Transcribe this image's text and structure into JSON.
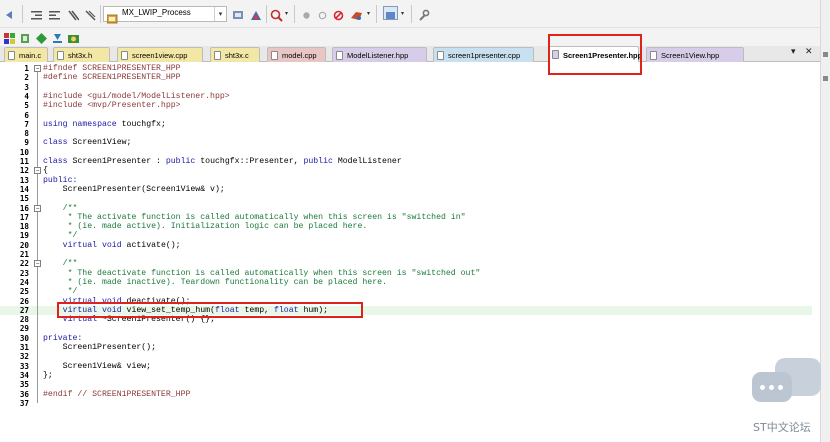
{
  "toolbar": {
    "process_combo": "MX_LWIP_Process",
    "colors": {
      "accent_red": "#e0221c"
    }
  },
  "tabs": [
    {
      "label": "main.c",
      "color": "#f3e7a6"
    },
    {
      "label": "sht3x.h",
      "color": "#f3e7a6"
    },
    {
      "label": "screen1view.cpp",
      "color": "#f3e7a6"
    },
    {
      "label": "sht3x.c",
      "color": "#f3e7a6"
    },
    {
      "label": "model.cpp",
      "color": "#e8c6c6"
    },
    {
      "label": "ModelListener.hpp",
      "color": "#d8cde8"
    },
    {
      "label": "screen1presenter.cpp",
      "color": "#c8e0ef"
    },
    {
      "label": "Screen1Presenter.hpp",
      "color": "#ffffff",
      "active": true
    },
    {
      "label": "Screen1View.hpp",
      "color": "#d8cde8"
    }
  ],
  "tab_controls": {
    "dropdown": "▾",
    "close": "✕"
  },
  "editor": {
    "lines": [
      {
        "n": "1",
        "text": "#ifndef SCREEN1PRESENTER_HPP",
        "cls": "t-pp"
      },
      {
        "n": "2",
        "text": "#define SCREEN1PRESENTER_HPP",
        "cls": "t-pp"
      },
      {
        "n": "3",
        "text": "",
        "cls": ""
      },
      {
        "n": "4",
        "text": "#include <gui/model/ModelListener.hpp>",
        "cls": "t-inc"
      },
      {
        "n": "5",
        "text": "#include <mvp/Presenter.hpp>",
        "cls": "t-inc"
      },
      {
        "n": "6",
        "text": "",
        "cls": ""
      },
      {
        "n": "7",
        "text": "using namespace touchgfx;",
        "cls": ""
      },
      {
        "n": "8",
        "text": "",
        "cls": ""
      },
      {
        "n": "9",
        "text": "class Screen1View;",
        "cls": ""
      },
      {
        "n": "10",
        "text": "",
        "cls": ""
      },
      {
        "n": "11",
        "text": "class Screen1Presenter : public touchgfx::Presenter, public ModelListener",
        "cls": ""
      },
      {
        "n": "12",
        "text": "{",
        "cls": ""
      },
      {
        "n": "13",
        "text": "public:",
        "cls": "t-kw"
      },
      {
        "n": "14",
        "text": "    Screen1Presenter(Screen1View& v);",
        "cls": ""
      },
      {
        "n": "15",
        "text": "",
        "cls": ""
      },
      {
        "n": "16",
        "text": "    /**",
        "cls": "t-cmt"
      },
      {
        "n": "17",
        "text": "     * The activate function is called automatically when this screen is \"switched in\"",
        "cls": "t-cmt"
      },
      {
        "n": "18",
        "text": "     * (ie. made active). Initialization logic can be placed here.",
        "cls": "t-cmt"
      },
      {
        "n": "19",
        "text": "     */",
        "cls": "t-cmt"
      },
      {
        "n": "20",
        "text": "    virtual void activate();",
        "cls": ""
      },
      {
        "n": "21",
        "text": "",
        "cls": ""
      },
      {
        "n": "22",
        "text": "    /**",
        "cls": "t-cmt"
      },
      {
        "n": "23",
        "text": "     * The deactivate function is called automatically when this screen is \"switched out\"",
        "cls": "t-cmt"
      },
      {
        "n": "24",
        "text": "     * (ie. made inactive). Teardown functionality can be placed here.",
        "cls": "t-cmt"
      },
      {
        "n": "25",
        "text": "     */",
        "cls": "t-cmt"
      },
      {
        "n": "26",
        "text": "    virtual void deactivate();",
        "cls": ""
      },
      {
        "n": "27",
        "text": "    virtual void view_set_temp_hum(float temp, float hum);",
        "cls": "",
        "highlight": true
      },
      {
        "n": "28",
        "text": "    virtual ~Screen1Presenter() {};",
        "cls": ""
      },
      {
        "n": "29",
        "text": "",
        "cls": ""
      },
      {
        "n": "30",
        "text": "private:",
        "cls": "t-kw"
      },
      {
        "n": "31",
        "text": "    Screen1Presenter();",
        "cls": ""
      },
      {
        "n": "32",
        "text": "",
        "cls": ""
      },
      {
        "n": "33",
        "text": "    Screen1View& view;",
        "cls": ""
      },
      {
        "n": "34",
        "text": "};",
        "cls": ""
      },
      {
        "n": "35",
        "text": "",
        "cls": ""
      },
      {
        "n": "36",
        "text": "#endif // SCREEN1PRESENTER_HPP",
        "cls": "t-pp"
      },
      {
        "n": "37",
        "text": "",
        "cls": ""
      }
    ]
  },
  "watermark": {
    "text": "ST中文论坛"
  }
}
